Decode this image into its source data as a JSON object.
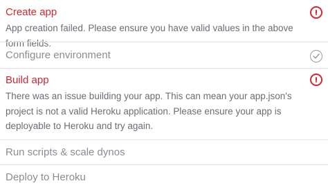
{
  "steps": [
    {
      "title": "Create app",
      "state": "error",
      "message": "App creation failed. Please ensure you have valid values in the above form fields.",
      "icon": "error-icon"
    },
    {
      "title": "Configure environment",
      "state": "done",
      "icon": "check-icon"
    },
    {
      "title": "Build app",
      "state": "error",
      "message": "There was an issue building your app. This can mean your app.json's project is not a valid Heroku application. Please ensure your app is deployable to Heroku and try again.",
      "icon": "error-icon"
    },
    {
      "title": "Run scripts & scale dynos",
      "state": "pending"
    },
    {
      "title": "Deploy to Heroku",
      "state": "pending"
    }
  ],
  "colors": {
    "error": "#d0282e",
    "muted": "#8a8c95",
    "text": "#6b6d75",
    "divider": "#e3e4e8"
  }
}
